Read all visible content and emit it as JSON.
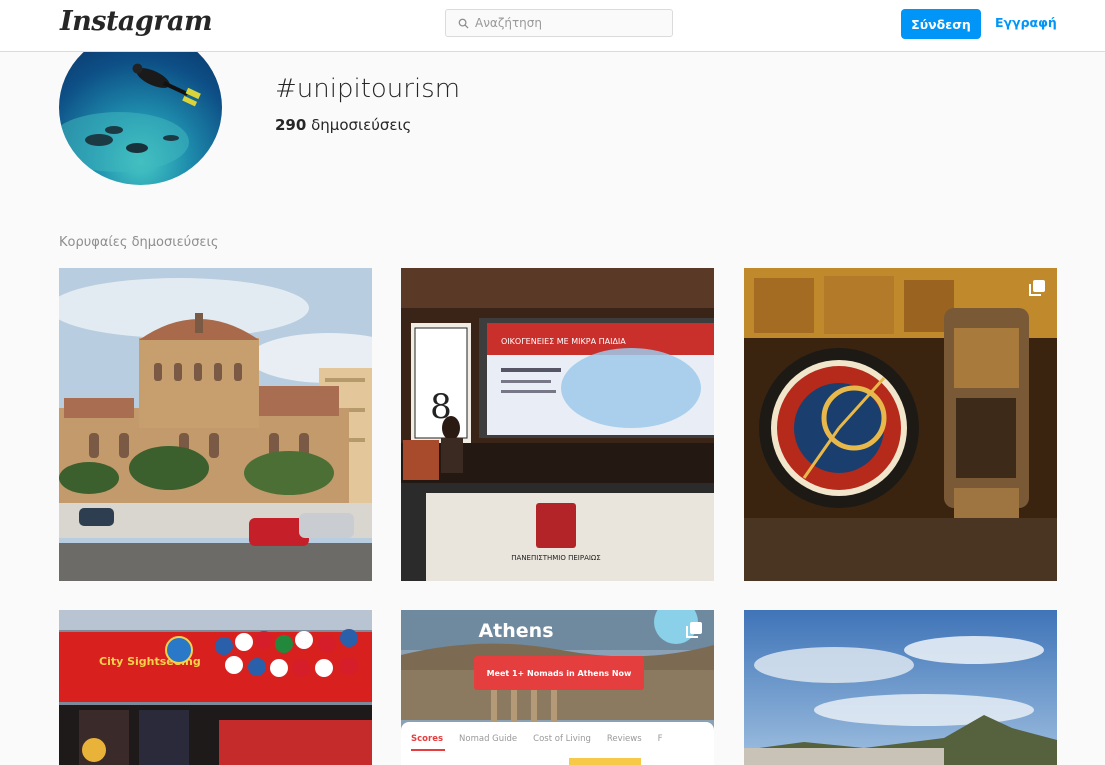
{
  "header": {
    "logo": "Instagram",
    "search_placeholder": "Αναζήτηση",
    "login_label": "Σύνδεση",
    "signup_label": "Εγγραφή"
  },
  "profile": {
    "hashtag": "#unipitourism",
    "post_count": "290",
    "post_label": "δημοσιεύσεις"
  },
  "top_posts": {
    "section_title": "Κορυφαίες δημοσιεύσεις",
    "posts": [
      {
        "subject": "church",
        "multi": false
      },
      {
        "subject": "conference",
        "multi": false
      },
      {
        "subject": "astronomical-clock",
        "multi": true
      },
      {
        "subject": "sightseeing-bus",
        "multi": false
      },
      {
        "subject": "nomad-list-athens",
        "multi": true
      },
      {
        "subject": "lycabettus-sky",
        "multi": false
      }
    ]
  },
  "conference_slide": {
    "screen_title": "ΟΙΚΟΓΕΝΕΙΕΣ ΜΕ ΜΙΚΡΑ ΠΑΙΔΙΑ",
    "podium_text": "ΠΑΝΕΠΙΣΤΗΜΙΟ ΠΕΙΡΑΙΩΣ"
  },
  "bus_sign": {
    "text": "City Sightseeing"
  },
  "athens_card": {
    "title": "Athens",
    "cta": "Meet 1+ Nomads in Athens Now",
    "tabs": [
      "Scores",
      "Nomad Guide",
      "Cost of Living",
      "Reviews",
      "F"
    ]
  },
  "colors": {
    "accent": "#0095f6",
    "background": "#fafafa",
    "muted_text": "#8e8e8e"
  }
}
